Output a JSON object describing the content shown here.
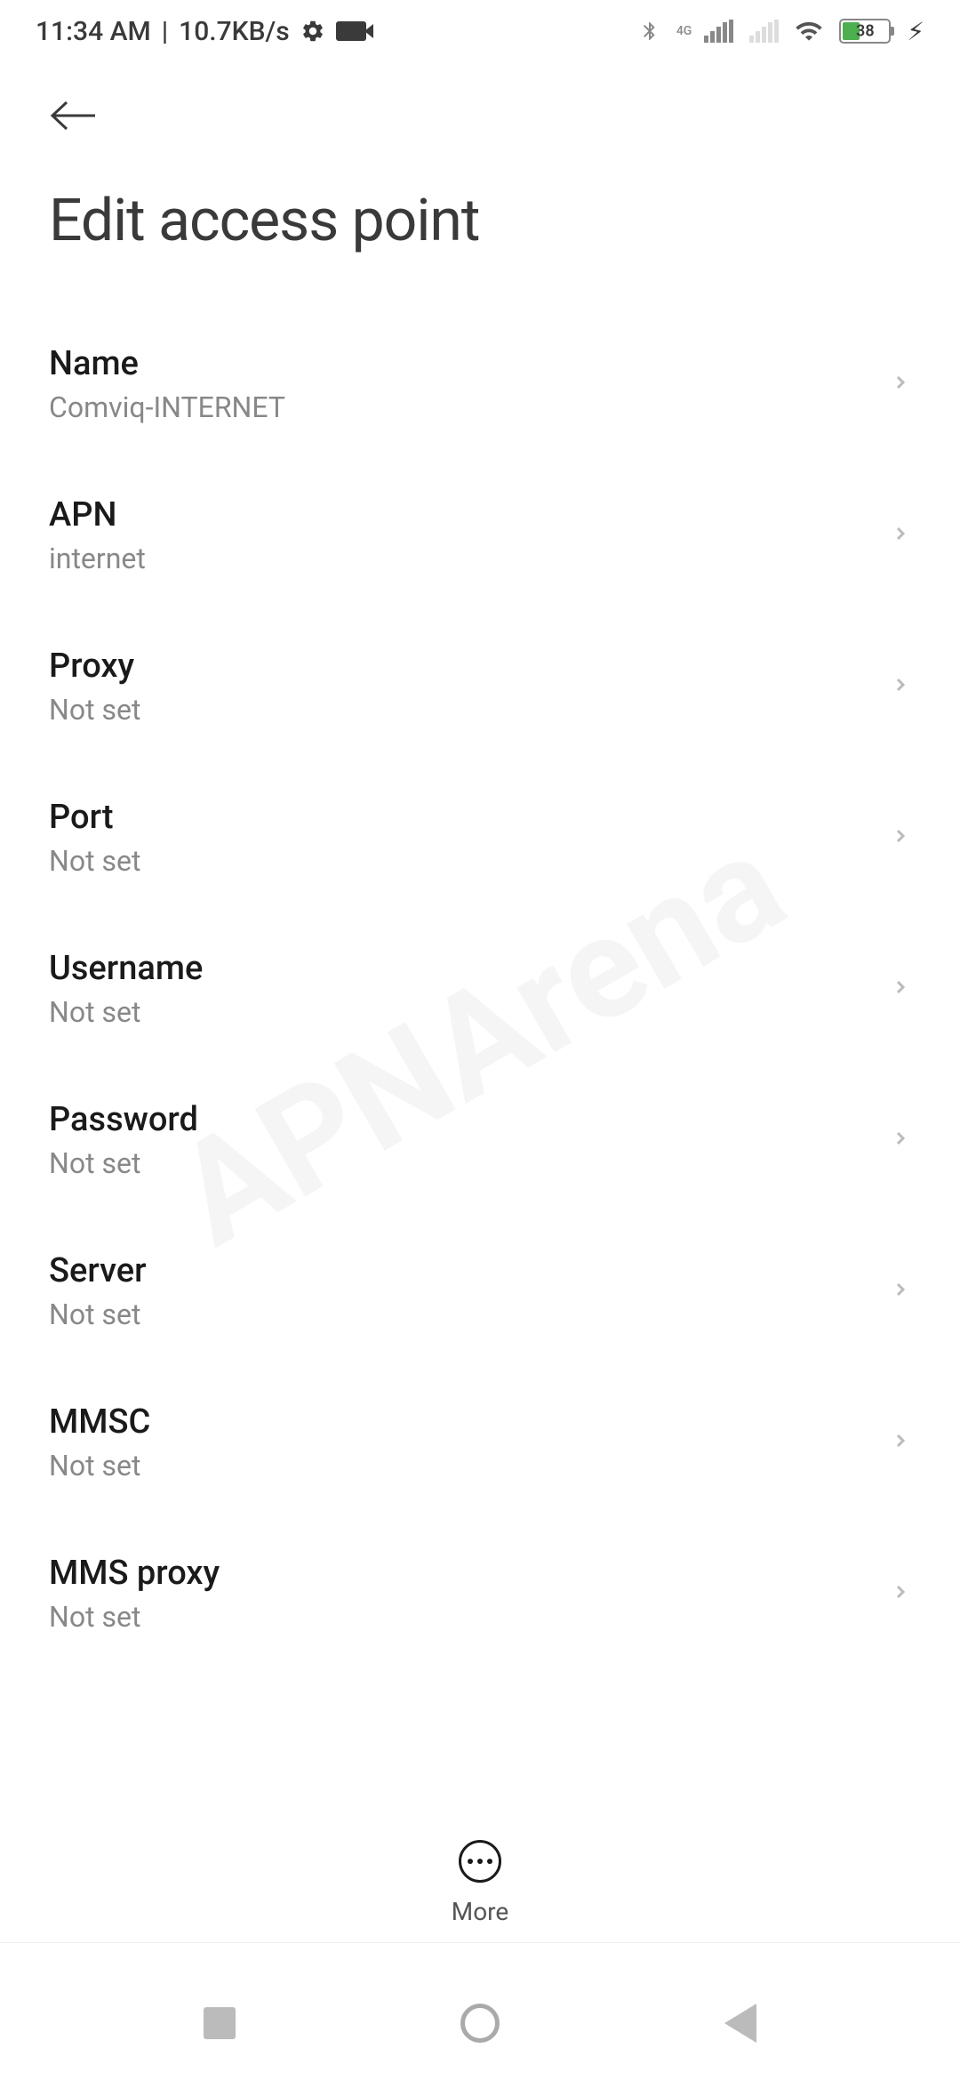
{
  "status_bar": {
    "time": "11:34 AM",
    "separator": "|",
    "data_speed": "10.7KB/s",
    "network_type": "4G",
    "battery_percent": "38",
    "battery_fill_width": "38%"
  },
  "header": {
    "page_title": "Edit access point"
  },
  "settings": [
    {
      "label": "Name",
      "value": "Comviq-INTERNET"
    },
    {
      "label": "APN",
      "value": "internet"
    },
    {
      "label": "Proxy",
      "value": "Not set"
    },
    {
      "label": "Port",
      "value": "Not set"
    },
    {
      "label": "Username",
      "value": "Not set"
    },
    {
      "label": "Password",
      "value": "Not set"
    },
    {
      "label": "Server",
      "value": "Not set"
    },
    {
      "label": "MMSC",
      "value": "Not set"
    },
    {
      "label": "MMS proxy",
      "value": "Not set"
    }
  ],
  "bottom_action": {
    "label": "More"
  },
  "watermark": "APNArena"
}
